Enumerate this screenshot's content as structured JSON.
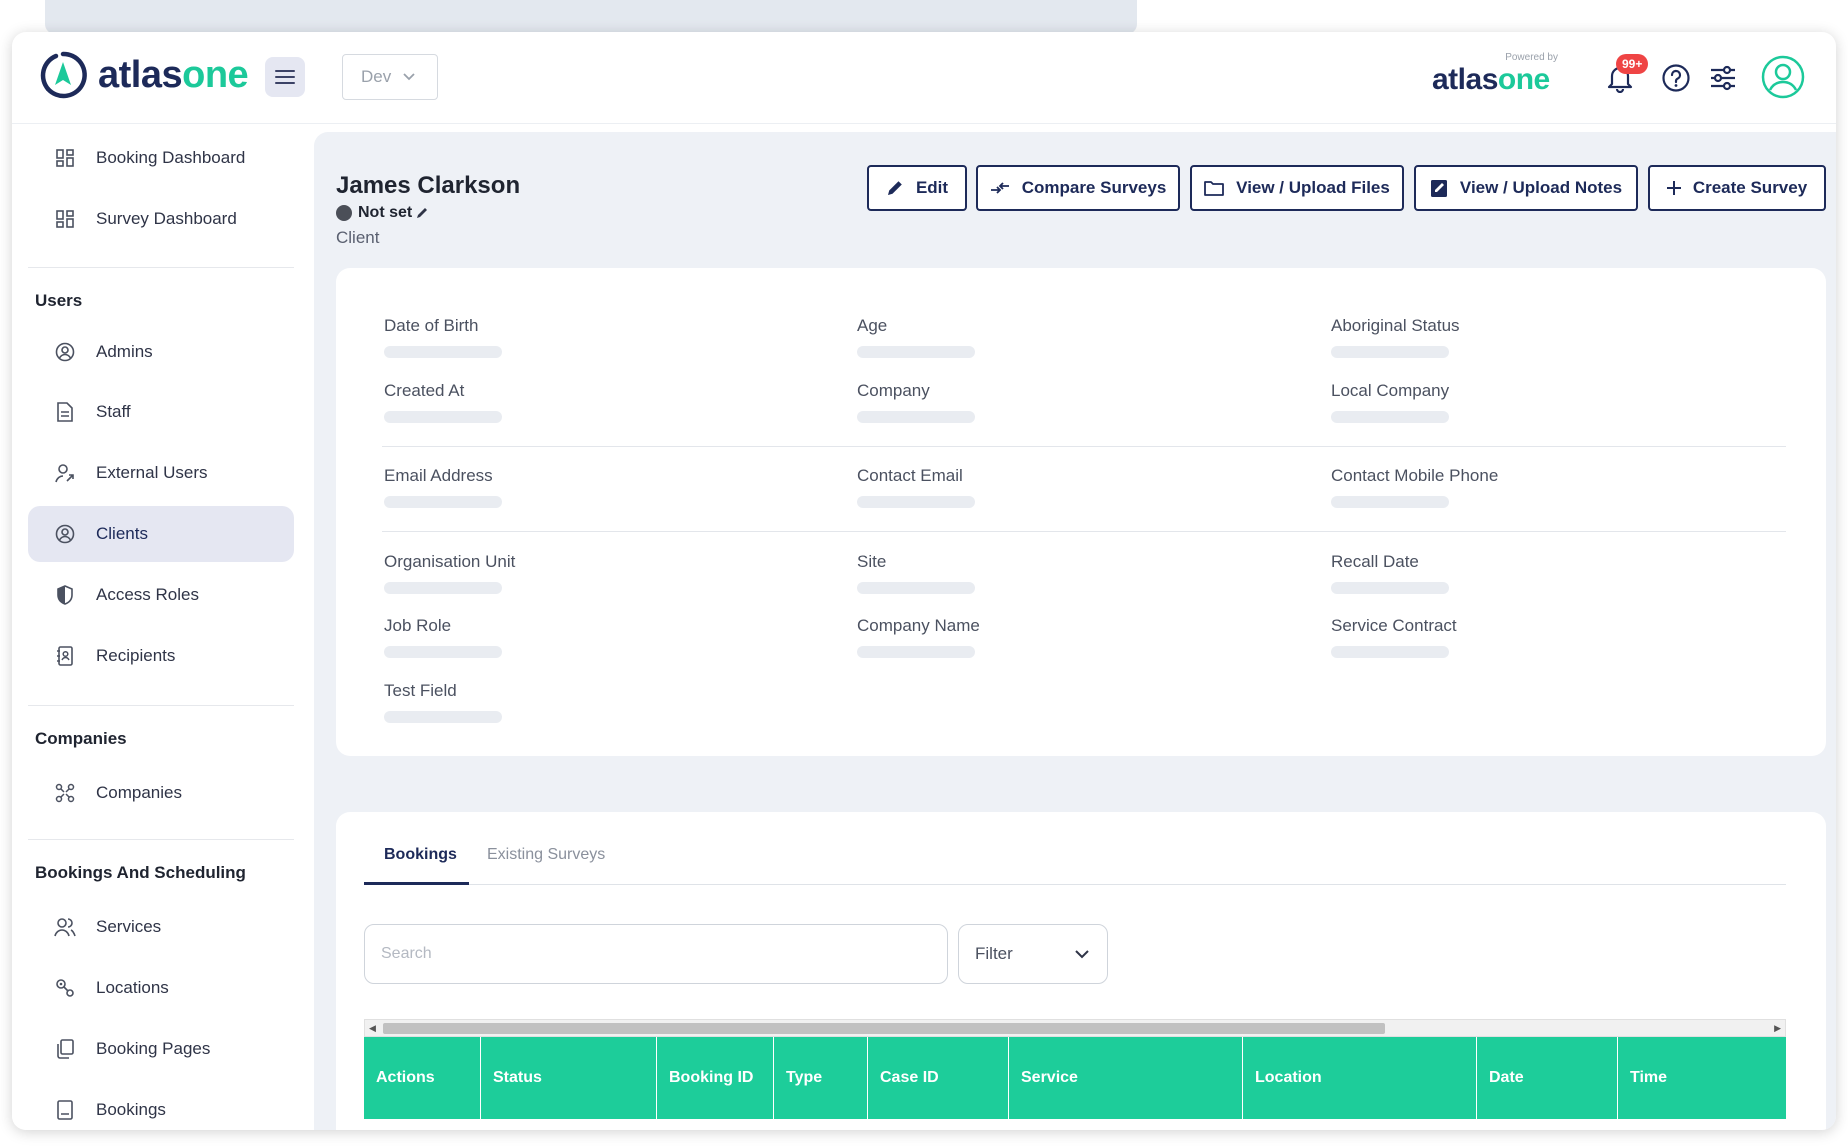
{
  "header": {
    "logo_text_a": "atlas",
    "logo_text_b": "one",
    "env": "Dev",
    "powered_by": "Powered by",
    "brand_a": "atlas",
    "brand_b": "one",
    "notifications_badge": "99+"
  },
  "sidebar": {
    "top_items": [
      {
        "label": "Booking Dashboard",
        "icon": "dashboard-icon"
      },
      {
        "label": "Survey Dashboard",
        "icon": "dashboard-icon"
      }
    ],
    "sections": [
      {
        "title": "Users",
        "items": [
          {
            "label": "Admins",
            "icon": "user-circle-icon"
          },
          {
            "label": "Staff",
            "icon": "document-icon"
          },
          {
            "label": "External Users",
            "icon": "user-arrow-icon"
          },
          {
            "label": "Clients",
            "icon": "user-circle-icon",
            "active": true
          },
          {
            "label": "Access Roles",
            "icon": "shield-icon"
          },
          {
            "label": "Recipients",
            "icon": "contact-book-icon"
          }
        ]
      },
      {
        "title": "Companies",
        "items": [
          {
            "label": "Companies",
            "icon": "network-icon"
          }
        ]
      },
      {
        "title": "Bookings And Scheduling",
        "items": [
          {
            "label": "Services",
            "icon": "users-icon"
          },
          {
            "label": "Locations",
            "icon": "location-icon"
          },
          {
            "label": "Booking Pages",
            "icon": "pages-icon"
          },
          {
            "label": "Bookings",
            "icon": "list-icon"
          }
        ]
      }
    ]
  },
  "client": {
    "name": "James Clarkson",
    "status": "Not set",
    "role": "Client"
  },
  "actions": {
    "edit": "Edit",
    "compare": "Compare Surveys",
    "files": "View / Upload Files",
    "notes": "View / Upload Notes",
    "create": "Create Survey"
  },
  "fields": {
    "dob": "Date of Birth",
    "age": "Age",
    "aboriginal": "Aboriginal Status",
    "created": "Created At",
    "company": "Company",
    "local_company": "Local Company",
    "email": "Email Address",
    "contact_email": "Contact Email",
    "contact_mobile": "Contact Mobile Phone",
    "org_unit": "Organisation Unit",
    "site": "Site",
    "recall": "Recall Date",
    "job_role": "Job Role",
    "company_name": "Company Name",
    "service_contract": "Service Contract",
    "test_field": "Test Field"
  },
  "tabs": {
    "bookings": "Bookings",
    "existing": "Existing Surveys"
  },
  "search": {
    "placeholder": "Search"
  },
  "filter": {
    "label": "Filter"
  },
  "table": {
    "columns": [
      "Actions",
      "Status",
      "Booking ID",
      "Type",
      "Case ID",
      "Service",
      "Location",
      "Date",
      "Time"
    ]
  },
  "colors": {
    "brand_navy": "#1d2a59",
    "brand_green": "#1cc99a",
    "table_header": "#1dcd9a",
    "badge": "#ef4444"
  }
}
